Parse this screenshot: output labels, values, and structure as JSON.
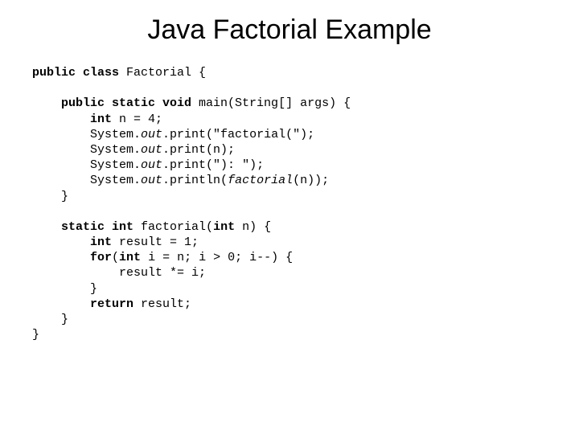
{
  "title": "Java Factorial Example",
  "code": {
    "l1_p1": "public class ",
    "l1_p2": "Factorial {",
    "l2_p1": "public static void ",
    "l2_p2": "main(String[] args) {",
    "l3_p1": "int ",
    "l3_p2": "n = 4;",
    "l4_p1": "System.",
    "l4_p2": "out",
    "l4_p3": ".print(\"factorial(\");",
    "l5_p1": "System.",
    "l5_p2": "out",
    "l5_p3": ".print(n);",
    "l6_p1": "System.",
    "l6_p2": "out",
    "l6_p3": ".print(\"): \");",
    "l7_p1": "System.",
    "l7_p2": "out",
    "l7_p3": ".println(",
    "l7_p4": "factorial",
    "l7_p5": "(n));",
    "l8": "}",
    "l9_p1": "static int ",
    "l9_p2": "factorial(",
    "l9_p3": "int ",
    "l9_p4": "n) {",
    "l10_p1": "int ",
    "l10_p2": "result = 1;",
    "l11_p1": "for",
    "l11_p2": "(",
    "l11_p3": "int ",
    "l11_p4": "i = n; i > 0; i--) {",
    "l12": "result *= i;",
    "l13": "}",
    "l14_p1": "return ",
    "l14_p2": "result;",
    "l15": "}",
    "l16": "}"
  }
}
